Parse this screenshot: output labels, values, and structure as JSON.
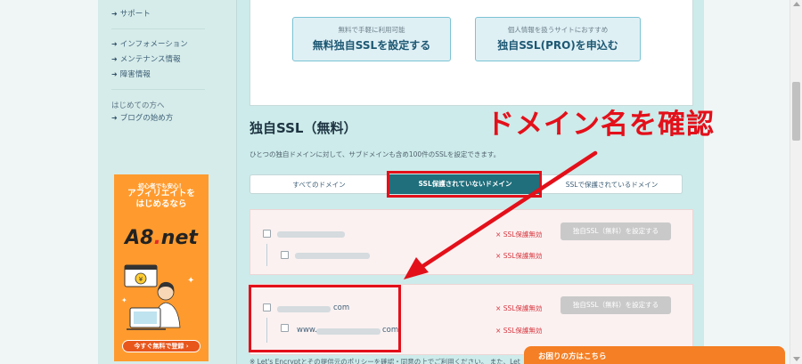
{
  "sidebar": {
    "support": "サポート",
    "information": "インフォメーション",
    "maintenance": "メンテナンス情報",
    "outage": "障害情報",
    "beginners_heading": "はじめての方へ",
    "blog_start": "ブログの始め方"
  },
  "banner": {
    "line1": "初心者でも安心！",
    "line2a": "アフィリエイトを",
    "line2b": "はじめるなら",
    "brand_a8": "A8",
    "brand_dot": ".",
    "brand_net": "net",
    "cta": "今すぐ無料で登録 ›"
  },
  "top_buttons": {
    "free_sub": "無料で手軽に利用可能",
    "free_main": "無料独自SSLを設定する",
    "pro_sub": "個人情報を扱うサイトにおすすめ",
    "pro_main": "独自SSL(PRO)を申込む"
  },
  "section": {
    "title": "独自SSL（無料）",
    "description": "ひとつの独自ドメインに対して、サブドメインも含め100件のSSLを設定できます。"
  },
  "tabs": {
    "all": "すべてのドメイン",
    "unprotected": "SSL保護されていないドメイン",
    "protected": "SSLで保護されているドメイン"
  },
  "domains": {
    "row2_tld": "com",
    "row2_sub_prefix": "www.",
    "row2_sub_tld": "com",
    "status_label": "SSL保護無効",
    "status_icon": "×",
    "action_label": "独自SSL（無料）を設定する"
  },
  "notice": "※ Let's Encryptとその提供元のポリシーを確認・同意の上でご利用ください。 また、Let",
  "help_bar": "お困りの方はこちら",
  "annotation": "ドメイン名を確認",
  "colors": {
    "annotation_red": "#e3101a",
    "active_tab": "#1f6f7c",
    "help_orange": "#f47f24"
  }
}
